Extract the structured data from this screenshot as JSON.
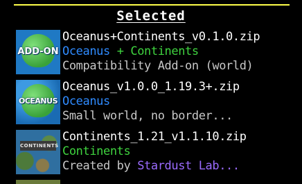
{
  "panel": {
    "title": "Selected"
  },
  "packs": [
    {
      "filename": "Oceanus+Continents_v0.1.0.zip",
      "title": "Oceanus + Continents",
      "title_parts": [
        "Oceanus",
        " + ",
        "Continents"
      ],
      "description": "Compatibility Add-on (world)",
      "icon": "add-on-pack-icon",
      "icon_text": "ADD-ON"
    },
    {
      "filename": "Oceanus_v1.0.0_1.19.3+.zip",
      "title": "Oceanus",
      "description": "Small world, no border...",
      "icon": "oceanus-pack-icon",
      "icon_text": "OCEANUS"
    },
    {
      "filename": "Continents_1.21_v1.1.10.zip",
      "title": "Continents",
      "description_prefix": "Created by ",
      "description_link": "Stardust Lab...",
      "icon": "continents-pack-icon",
      "icon_text": "CONTINENTS"
    }
  ],
  "colors": {
    "accent_line": "#ffff4a",
    "oceanus_blue": "#2f8bff",
    "continents_green": "#3fd33f",
    "description_gray": "#c8c8c8",
    "author_purple": "#9b6bff"
  }
}
